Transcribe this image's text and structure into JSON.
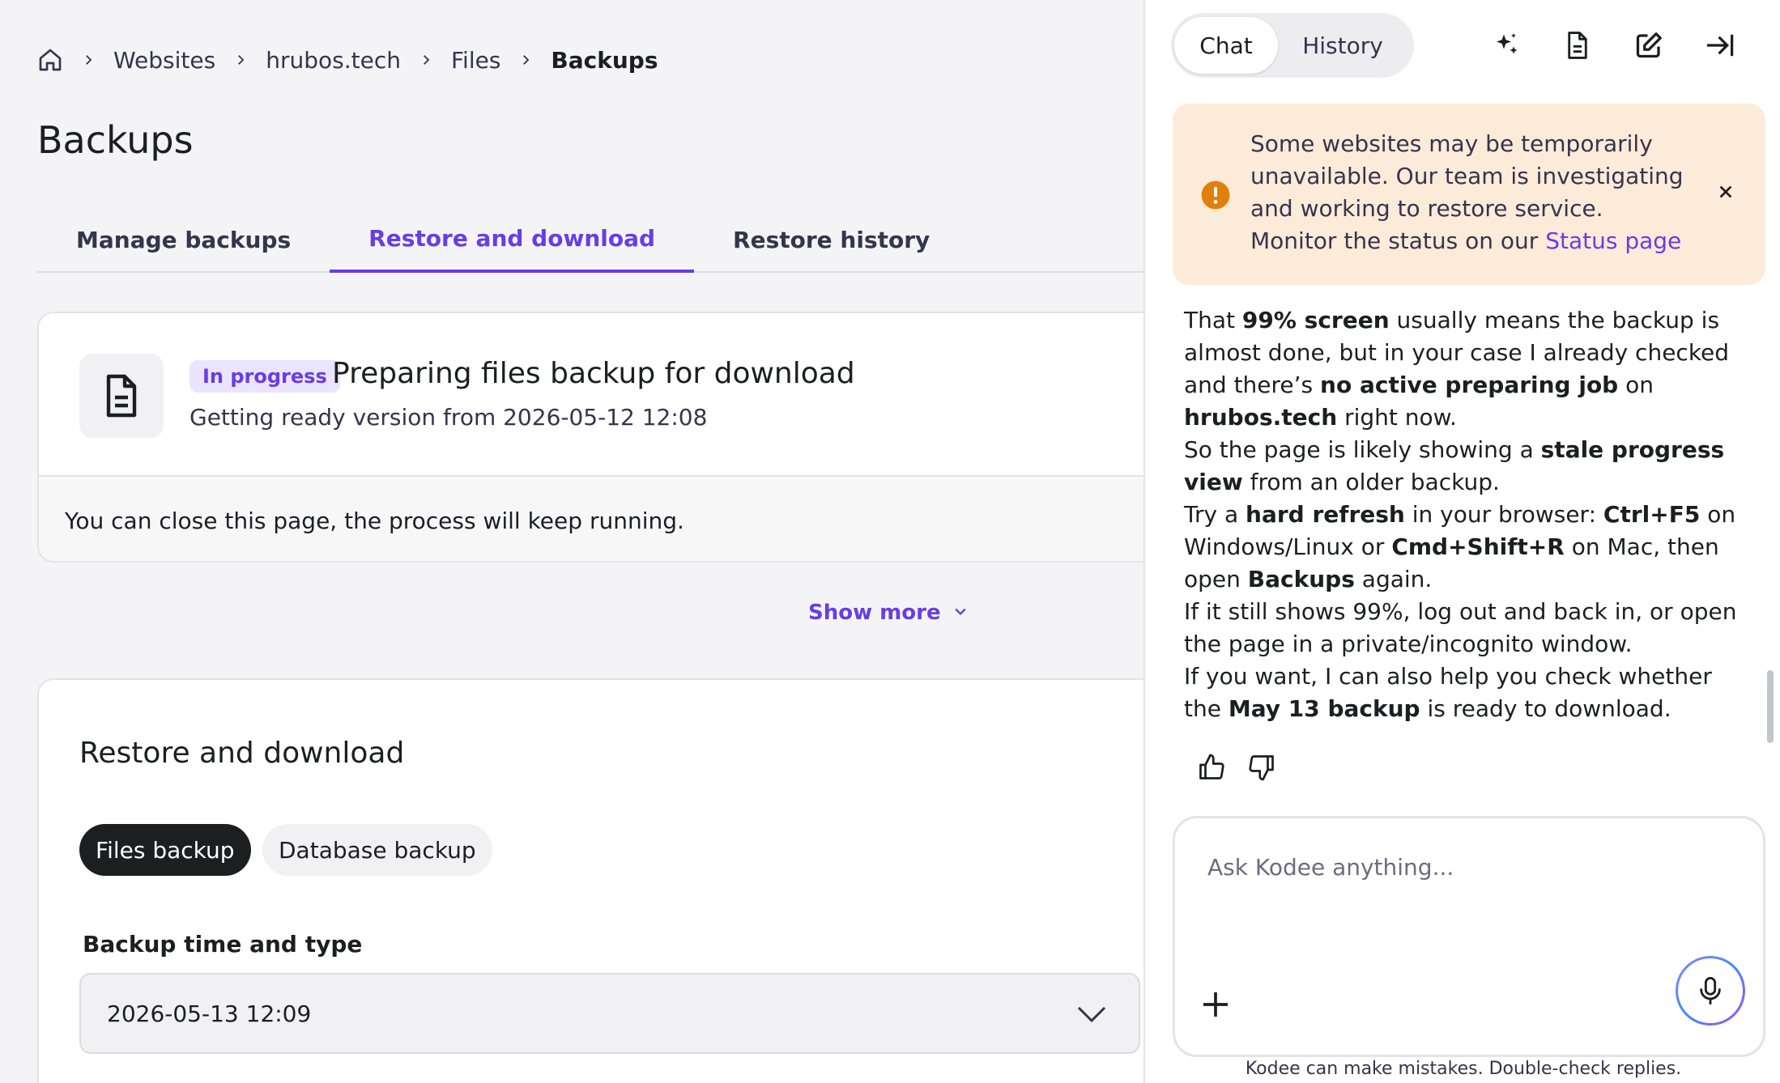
{
  "breadcrumb": {
    "home_icon": "home-icon",
    "items": [
      "Websites",
      "hrubos.tech",
      "Files"
    ],
    "current": "Backups"
  },
  "page": {
    "title": "Backups"
  },
  "tabs": [
    {
      "label": "Manage backups",
      "active": false
    },
    {
      "label": "Restore and download",
      "active": true
    },
    {
      "label": "Restore history",
      "active": false
    }
  ],
  "progress_card": {
    "icon": "file-icon",
    "badge": "In progress",
    "title": "Preparing files backup for download",
    "subtitle": "Getting ready version from 2026-05-12 12:08",
    "footer_note": "You can close this page, the process will keep running."
  },
  "show_more": {
    "label": "Show more"
  },
  "restore_card": {
    "title": "Restore and download",
    "pills": {
      "files": "Files backup",
      "database": "Database backup"
    },
    "field_label": "Backup time and type",
    "selected_value": "2026-05-13 12:09"
  },
  "chat": {
    "tabs": {
      "chat": "Chat",
      "history": "History"
    },
    "toolbar_icons": [
      "sparkles-icon",
      "document-icon",
      "edit-icon",
      "collapse-panel-icon"
    ],
    "alert": {
      "text": "Some websites may be temporarily unavailable. Our team is investigating and working to restore service.",
      "link_prefix": "Monitor the status on our",
      "link": "Status page"
    },
    "message": {
      "p1a": "That ",
      "p1b": "99% screen",
      "p1c": " usually means the backup is almost done, but in your case I already checked and there’s ",
      "p1d": "no active preparing job",
      "p1e": " on ",
      "p1f": "hrubos.tech",
      "p1g": " right now.",
      "p2a": "So the page is likely showing a ",
      "p2b": "stale progress view",
      "p2c": " from an older backup.",
      "p3a": "Try a ",
      "p3b": "hard refresh",
      "p3c": " in your browser: ",
      "p3d": "Ctrl+F5",
      "p3e": " on Windows/Linux or ",
      "p3f": "Cmd+Shift+R",
      "p3g": " on Mac, then open ",
      "p3h": "Backups",
      "p3i": " again.",
      "p4": "If it still shows 99%, log out and back in, or open the page in a private/incognito window.",
      "p5a": "If you want, I can also help you check whether the ",
      "p5b": "May 13 backup",
      "p5c": " is ready to download."
    },
    "composer_placeholder": "Ask Kodee anything...",
    "disclaimer": "Kodee can make mistakes. Double-check replies."
  },
  "colors": {
    "accent": "#673de6",
    "warning": "#e0800b",
    "alert_bg": "#fdebd9"
  }
}
